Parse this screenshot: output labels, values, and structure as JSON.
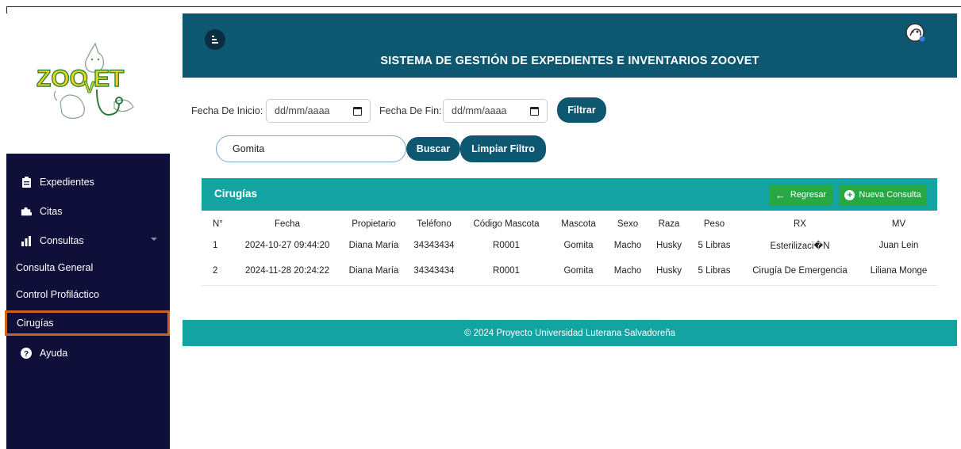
{
  "header": {
    "title": "SISTEMA DE GESTIÓN DE EXPEDIENTES E INVENTARIOS ZOOVET"
  },
  "sidebar": {
    "items": [
      {
        "label": "Expedientes",
        "icon": "clipboard-icon"
      },
      {
        "label": "Citas",
        "icon": "puzzle-icon"
      },
      {
        "label": "Consultas",
        "icon": "chart-bar-icon"
      },
      {
        "label": "Consulta General"
      },
      {
        "label": "Control Profiláctico"
      },
      {
        "label": "Cirugías",
        "active": true
      },
      {
        "label": "Ayuda",
        "icon": "help-circle-icon"
      }
    ]
  },
  "filters": {
    "start_label": "Fecha De Inicio:",
    "start_value": "dd/mm/aaaa",
    "end_label": "Fecha De Fin:",
    "end_value": "dd/mm/aaaa",
    "filter_button": "Filtrar",
    "search_value": "Gomita",
    "search_button": "Buscar",
    "clear_button": "Limpiar Filtro"
  },
  "card": {
    "title": "Cirugías",
    "back_button": "Regresar",
    "new_button": "Nueva Consulta"
  },
  "table": {
    "columns": [
      "N°",
      "Fecha",
      "Propietario",
      "Teléfono",
      "Código Mascota",
      "Mascota",
      "Sexo",
      "Raza",
      "Peso",
      "RX",
      "MV"
    ],
    "rows": [
      [
        "1",
        "2024-10-27 09:44:20",
        "Diana María",
        "34343434",
        "R0001",
        "Gomita",
        "Macho",
        "Husky",
        "5 Libras",
        "Esterilizaci�N",
        "Juan Lein"
      ],
      [
        "2",
        "2024-11-28 20:24:22",
        "Diana María",
        "34343434",
        "R0001",
        "Gomita",
        "Macho",
        "Husky",
        "5 Libras",
        "Cirugía De Emergencia",
        "Liliana Monge"
      ]
    ]
  },
  "footer": {
    "text": "© 2024 Proyecto Universidad Luterana Salvadoreña"
  },
  "colors": {
    "sidebar_bg": "#0f0f3a",
    "header_bg": "#0e5770",
    "teal": "#13a3a1",
    "green_button": "#28a745",
    "active_outline": "#c8641e"
  }
}
